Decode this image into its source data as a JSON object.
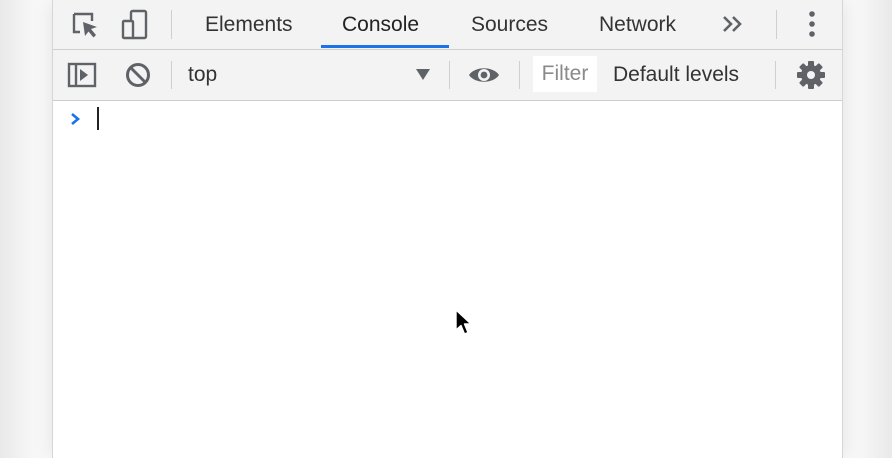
{
  "tabs": [
    {
      "label": "Elements",
      "active": false
    },
    {
      "label": "Console",
      "active": true
    },
    {
      "label": "Sources",
      "active": false
    },
    {
      "label": "Network",
      "active": false
    }
  ],
  "icons": {
    "inspect": "inspect-element-icon",
    "device": "device-toolbar-icon",
    "more_tabs": "more-tabs-icon",
    "menu": "kebab-menu-icon",
    "sidebar": "show-console-sidebar-icon",
    "clear": "clear-console-icon",
    "dropdown": "dropdown-arrow-icon",
    "eye": "live-expression-eye-icon",
    "settings": "gear-icon",
    "prompt": "prompt-chevron-icon"
  },
  "toolbar": {
    "context": "top",
    "filter_placeholder": "Filter",
    "levels_label": "Default levels"
  },
  "console": {
    "input_value": ""
  },
  "colors": {
    "accent": "#1a73e8",
    "toolbar_bg": "#f3f3f3",
    "icon": "#5f6368"
  }
}
